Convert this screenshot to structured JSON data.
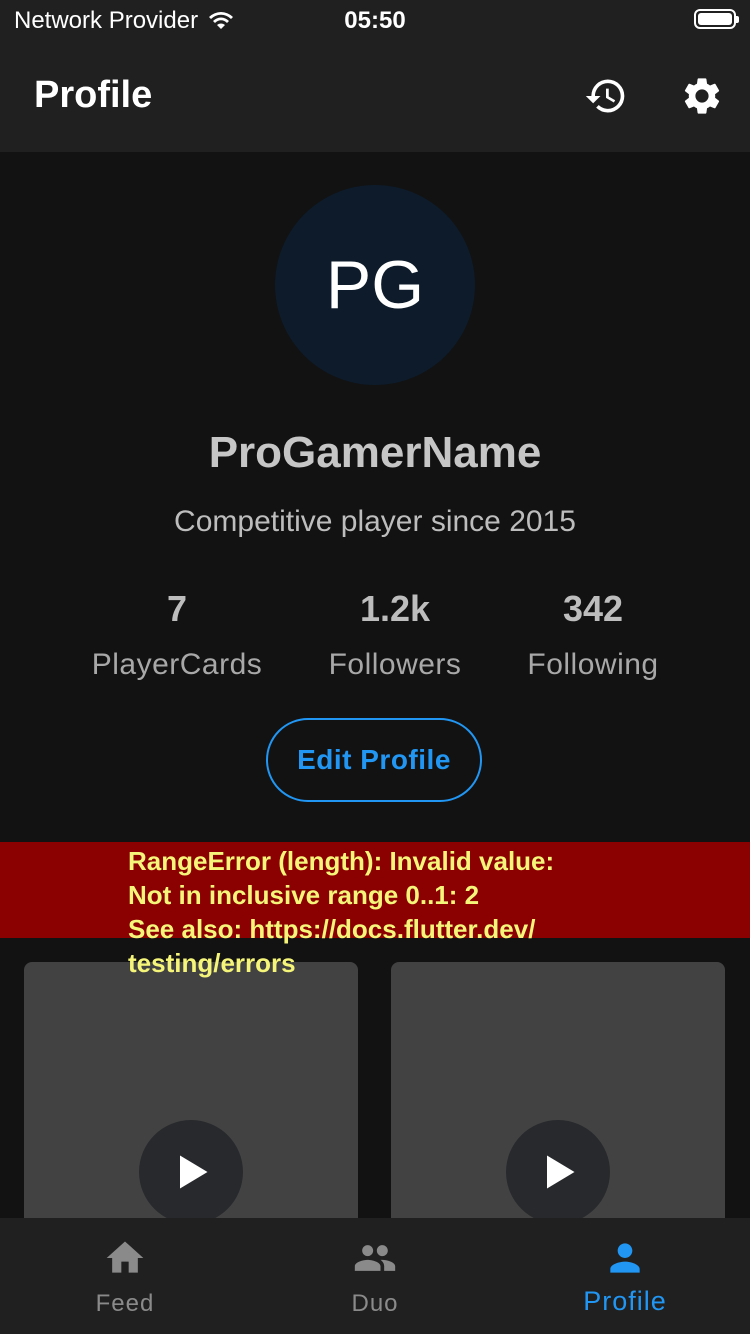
{
  "status_bar": {
    "carrier": "Network Provider",
    "time": "05:50"
  },
  "app_bar": {
    "title": "Profile",
    "icons": [
      "history-icon",
      "settings-icon"
    ]
  },
  "profile": {
    "initials": "PG",
    "username": "ProGamerName",
    "bio": "Competitive player since 2015",
    "stats": [
      {
        "value": "7",
        "label": "PlayerCards"
      },
      {
        "value": "1.2k",
        "label": "Followers"
      },
      {
        "value": "342",
        "label": "Following"
      }
    ],
    "edit_button": "Edit Profile"
  },
  "error": {
    "message": "RangeError (length): Invalid value:\nNot in inclusive range 0..1: 2\nSee also: https://docs.flutter.dev/\ntesting/errors"
  },
  "bottom_nav": {
    "items": [
      {
        "label": "Feed",
        "icon": "home-icon",
        "active": false
      },
      {
        "label": "Duo",
        "icon": "people-icon",
        "active": false
      },
      {
        "label": "Profile",
        "icon": "person-icon",
        "active": true
      }
    ]
  },
  "colors": {
    "accent": "#2196f3",
    "error_bg": "#8b0000",
    "error_text": "#f5f57a",
    "background": "#121212",
    "bar": "#202020"
  }
}
